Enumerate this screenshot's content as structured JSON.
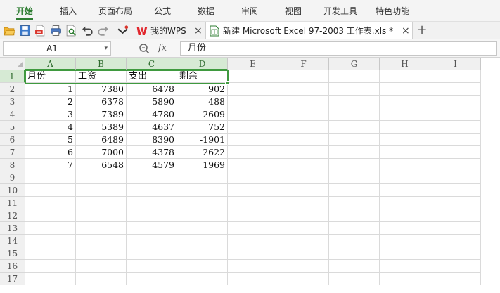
{
  "ribbon": {
    "tabs": [
      "开始",
      "插入",
      "页面布局",
      "公式",
      "数据",
      "审阅",
      "视图",
      "开发工具",
      "特色功能"
    ],
    "active_index": 0,
    "accent_color": "#2e7d32"
  },
  "toolbar": {
    "icons": [
      "folder-open-icon",
      "save-icon",
      "export-pdf-icon",
      "print-icon",
      "print-preview-icon",
      "undo-icon",
      "redo-icon",
      "customize-dropdown-icon"
    ]
  },
  "doc_tabs": {
    "wps": {
      "label": "我的WPS",
      "close": "×"
    },
    "excel": {
      "label": "新建 Microsoft Excel 97-2003 工作表.xls *",
      "close": "×"
    },
    "add": "+"
  },
  "formula_bar": {
    "name_box": "A1",
    "name_box_arrow": "▾",
    "fx": "fx",
    "content": "月份"
  },
  "sheet": {
    "columns": [
      "A",
      "B",
      "C",
      "D",
      "E",
      "F",
      "G",
      "H",
      "I"
    ],
    "rows": [
      "1",
      "2",
      "3",
      "4",
      "5",
      "6",
      "7",
      "8",
      "9",
      "10",
      "11",
      "12",
      "13",
      "14",
      "15",
      "16",
      "17"
    ],
    "selected_columns": [
      "A",
      "B",
      "C",
      "D"
    ],
    "selected_row": "1",
    "header_cells": [
      "月份",
      "工资",
      "支出",
      "剩余"
    ],
    "data_rows": [
      [
        "1",
        "7380",
        "6478",
        "902"
      ],
      [
        "2",
        "6378",
        "5890",
        "488"
      ],
      [
        "3",
        "7389",
        "4780",
        "2609"
      ],
      [
        "4",
        "5389",
        "4637",
        "752"
      ],
      [
        "5",
        "6489",
        "8390",
        "-1901"
      ],
      [
        "6",
        "7000",
        "4378",
        "2622"
      ],
      [
        "7",
        "6548",
        "4579",
        "1969"
      ]
    ],
    "selection_color": "#3f9a3f"
  }
}
